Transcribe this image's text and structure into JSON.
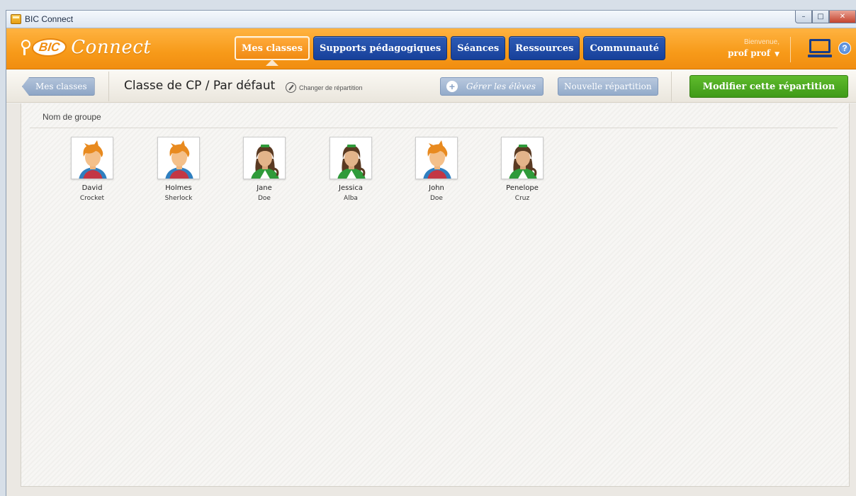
{
  "window": {
    "title": "BIC Connect"
  },
  "header": {
    "logo_bic": "BIC",
    "logo_connect": "Connect",
    "tabs": [
      {
        "label": "Mes classes",
        "active": true
      },
      {
        "label": "Supports pédagogiques",
        "active": false
      },
      {
        "label": "Séances",
        "active": false
      },
      {
        "label": "Ressources",
        "active": false
      },
      {
        "label": "Communauté",
        "active": false
      }
    ],
    "welcome": "Bienvenue,",
    "user": "prof  prof",
    "help": "?"
  },
  "toolbar": {
    "back_label": "Mes classes",
    "breadcrumb": "Classe de CP /  Par défaut",
    "change_label": "Changer de répartition",
    "gerer_label": "Gérer les élèves",
    "nouvelle_label": "Nouvelle répartition",
    "modifier_label": "Modifier cette répartition"
  },
  "group": {
    "name": "Nom de groupe",
    "students": [
      {
        "first": "David",
        "last": "Crocket",
        "gender": "boy"
      },
      {
        "first": "Holmes",
        "last": "Sherlock",
        "gender": "boy"
      },
      {
        "first": "Jane",
        "last": "Doe",
        "gender": "girl"
      },
      {
        "first": "Jessica",
        "last": "Alba",
        "gender": "girl"
      },
      {
        "first": "John",
        "last": "Doe",
        "gender": "boy"
      },
      {
        "first": "Penelope",
        "last": "Cruz",
        "gender": "girl"
      }
    ]
  },
  "colors": {
    "header_orange": "#f79a19",
    "tab_blue": "#1d47a3",
    "action_green": "#4aa71f",
    "secondary_blue": "#9fb4d1"
  }
}
